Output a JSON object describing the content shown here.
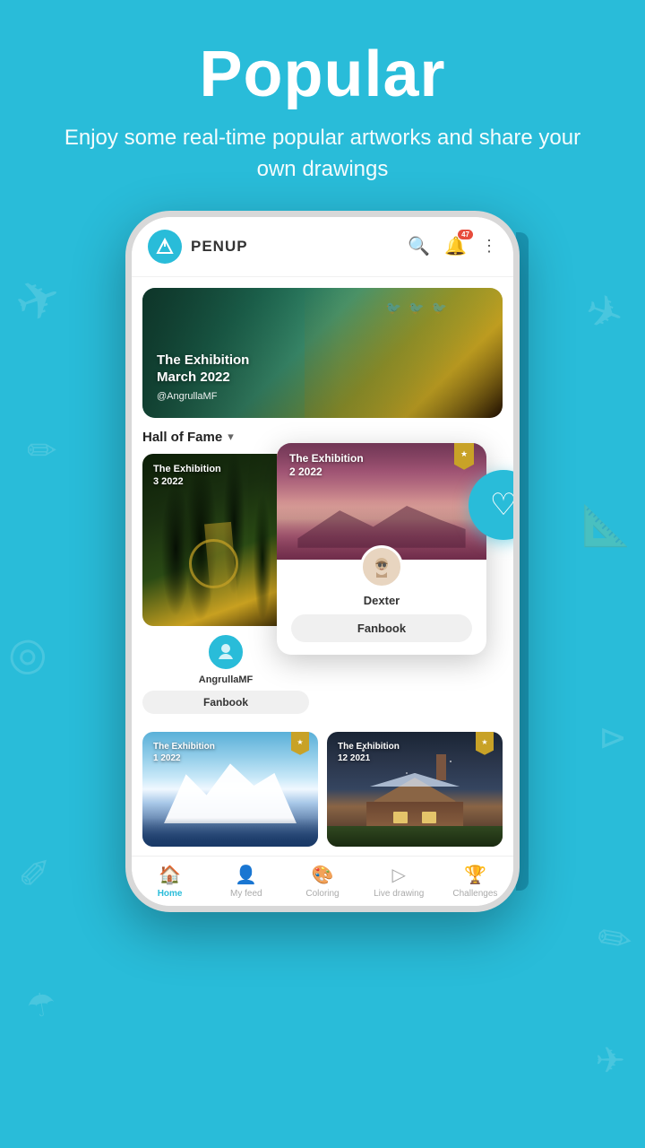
{
  "header": {
    "title": "Popular",
    "subtitle": "Enjoy some real-time popular artworks and share your own drawings"
  },
  "app": {
    "name": "PENUP",
    "notification_count": "47"
  },
  "banner": {
    "title": "The Exhibition\nMarch 2022",
    "author": "@AngrullaMF"
  },
  "hof": {
    "title": "Hall of Fame",
    "dropdown": "▾"
  },
  "cards": [
    {
      "title": "The Exhibition\n3 2022",
      "artist": "AngrullaMF",
      "fanbook_label": "Fanbook"
    },
    {
      "title": "The Exhibition\n2 2022",
      "artist": "Dexter",
      "fanbook_label": "Fanbook"
    }
  ],
  "bottom_cards": [
    {
      "title": "The Exhibition\n1 2022"
    },
    {
      "title": "The Exhibition\n12 2021"
    }
  ],
  "nav": {
    "items": [
      {
        "label": "Home",
        "active": true
      },
      {
        "label": "My feed",
        "active": false
      },
      {
        "label": "Coloring",
        "active": false
      },
      {
        "label": "Live drawing",
        "active": false
      },
      {
        "label": "Challenges",
        "active": false
      }
    ]
  },
  "colors": {
    "primary": "#29bcd9",
    "bookmark": "#c8a227",
    "active_nav": "#29bcd9"
  }
}
